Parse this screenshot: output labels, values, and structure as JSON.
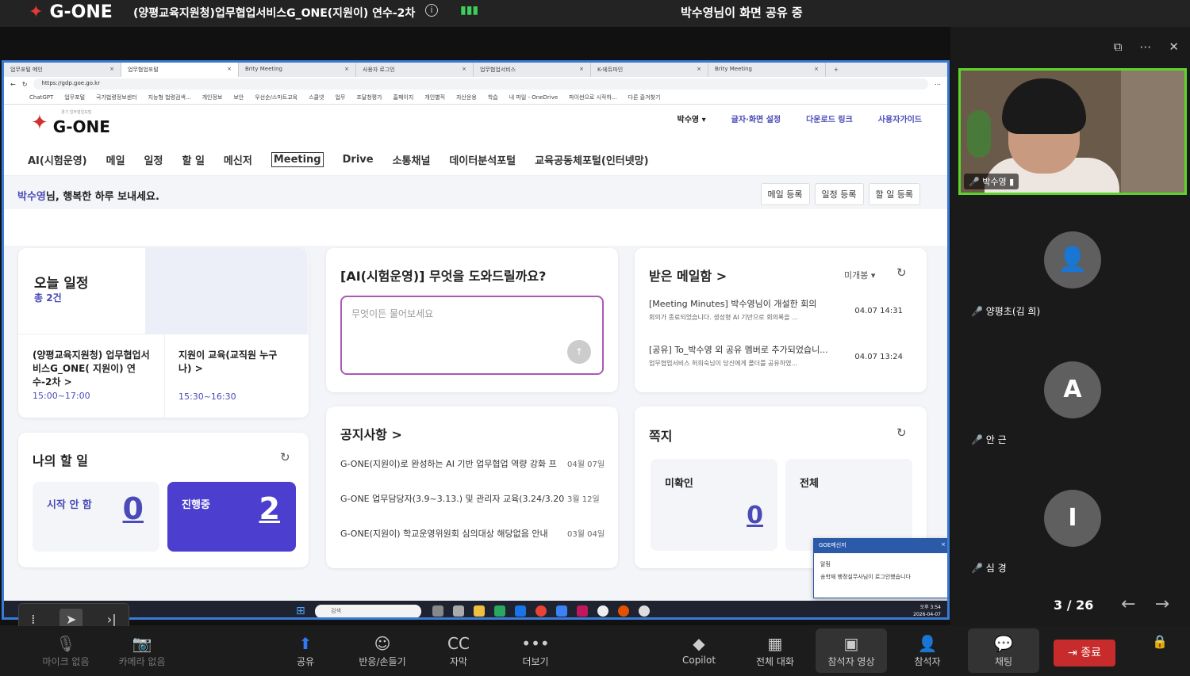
{
  "meeting": {
    "app_logo": "G-ONE",
    "title": "(양평교육지원청)업무협업서비스G_ONE(지원이) 연수-2차",
    "share_status": "박수영님이 화면 공유 중"
  },
  "browser": {
    "tabs": [
      "업무포털 메인",
      "업무협업포털",
      "Brity Meeting",
      "사용자 로그인",
      "업무협업서비스",
      "K-에듀파인",
      "Brity Meeting"
    ],
    "url": "https://gdp.goe.go.kr",
    "bookmarks": [
      "ChatGPT",
      "업무포털",
      "국가법령정보센터",
      "지능형 법령검색...",
      "개인정보",
      "보안",
      "우선순/스마트교육",
      "스쿨넷",
      "업무",
      "조달청평가",
      "홈페이지",
      "개인별직",
      "자산운용",
      "학습",
      "내 파일 - OneDrive",
      "파이썬으로 시작하...",
      "다른 즐겨찾기"
    ]
  },
  "gone": {
    "logo_sub": "경기 업무협업포털",
    "logo": "G-ONE",
    "user": "박수영",
    "header_links": [
      "글자·화면 설정",
      "다운로드 링크",
      "사용자가이드"
    ],
    "nav": [
      "AI(시험운영)",
      "메일",
      "일정",
      "할 일",
      "메신저",
      "Meeting",
      "Drive",
      "소통채널",
      "데이터분석포털",
      "교육공동체포털(인터넷망)"
    ],
    "greeting_name": "박수영",
    "greeting_rest": "님, 행복한 하루 보내세요.",
    "quick": [
      "메일 등록",
      "일정 등록",
      "할 일 등록"
    ],
    "today": {
      "title": "오늘 일정",
      "count": "총 2건",
      "items": [
        {
          "title": "(양평교육지원청) 업무협업서비스G_ONE( 지원이) 연수-2차 >",
          "time": "15:00~17:00"
        },
        {
          "title": "지원이 교육(교직원 누구나) >",
          "time": "15:30~16:30"
        }
      ]
    },
    "ai": {
      "title": "[AI(시험운영)] 무엇을 도와드릴까요?",
      "placeholder": "무엇이든 물어보세요",
      "send": "↑"
    },
    "mail": {
      "title": "받은 메일함 >",
      "filter": "미개봉",
      "items": [
        {
          "subject": "[Meeting Minutes] 박수영님이 개설한 회의",
          "preview": "회의가 종료되었습니다. 생성형 AI 기반으로 회의록을 ...",
          "date": "04.07 14:31"
        },
        {
          "subject": "[공유] To_박수영 외 공유 멤버로 추가되었습니...",
          "preview": "업무협업서비스 허희숙님이 당신에게 폴더를 공유하였...",
          "date": "04.07 13:24"
        }
      ]
    },
    "todo": {
      "title": "나의 할 일",
      "not_started_label": "시작 안 함",
      "not_started": "0",
      "in_progress_label": "진행중",
      "in_progress": "2"
    },
    "notice": {
      "title": "공지사항 >",
      "items": [
        {
          "text": "G-ONE(지원이)로 완성하는 AI 기반 업무협업 역량 강화 프",
          "date": "04월 07일"
        },
        {
          "text": "G-ONE 업무담당자(3.9~3.13.) 및 관리자 교육(3.24/3.20",
          "date": "3월 12일"
        },
        {
          "text": "G-ONE(지원이) 학교운영위원회 심의대상 해당없음 안내",
          "date": "03월 04일"
        }
      ]
    },
    "memo": {
      "title": "쪽지",
      "unread_label": "미확인",
      "unread": "0",
      "all_label": "전체"
    },
    "popup": {
      "title": "GOE메신저",
      "head": "알림",
      "body": "송학재 행정실무사님이 로그인했습니다"
    }
  },
  "taskbar": {
    "search": "검색",
    "time": "오후 3:54",
    "date": "2026-04-07"
  },
  "participants": {
    "main_name": "박수영",
    "others": [
      {
        "initial": "",
        "name": "양평초(김 희)"
      },
      {
        "initial": "A",
        "name": "안 근"
      },
      {
        "initial": "I",
        "name": "심 경"
      }
    ],
    "page": "3 / 26"
  },
  "toolbar": {
    "mic": "마이크 없음",
    "camera": "카메라 없음",
    "share": "공유",
    "reaction": "반응/손들기",
    "caption": "자막",
    "more": "더보기",
    "copilot": "Copilot",
    "chat_all": "전체 대화",
    "video": "참석자 영상",
    "attendees": "참석자",
    "chat": "채팅",
    "end": "종료"
  },
  "colors": {
    "accent": "#4a4ab8",
    "highlight_border": "#5cd52a",
    "end": "#c72b2b"
  }
}
